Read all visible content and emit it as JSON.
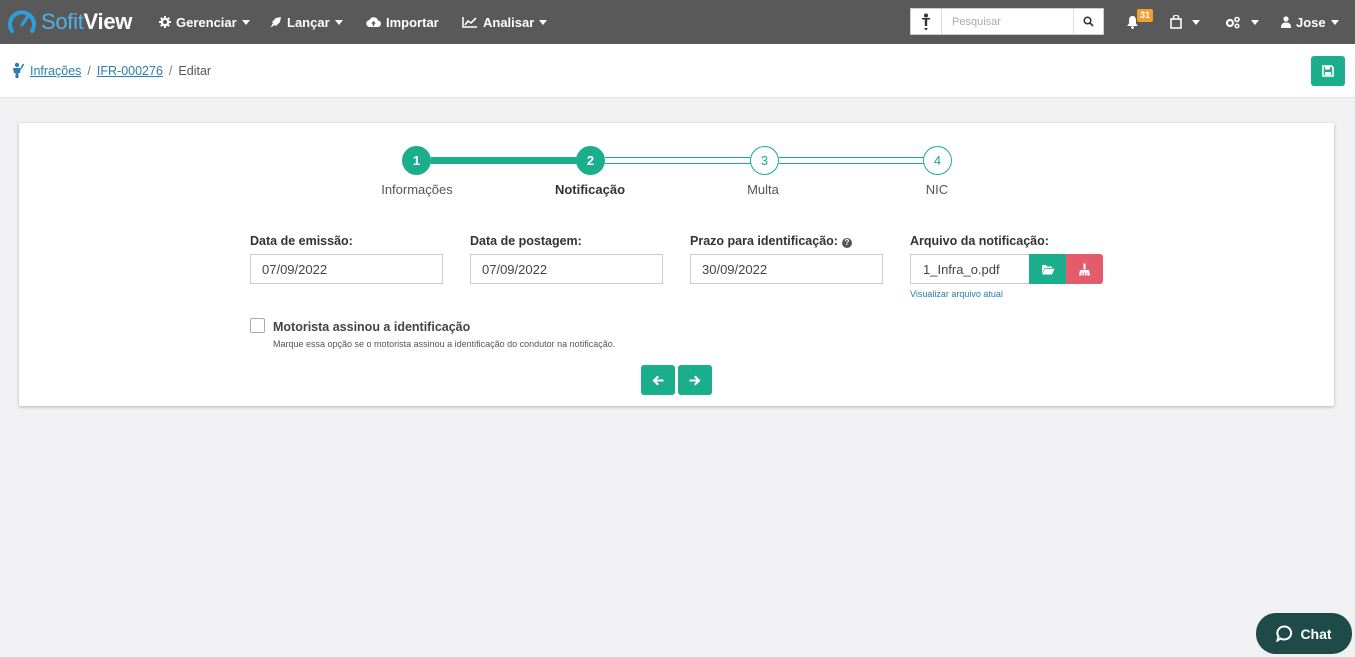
{
  "app": {
    "logo_soft": "Sofit",
    "logo_view": "View"
  },
  "nav": {
    "items": [
      {
        "label": "Gerenciar",
        "icon": "gear-icon",
        "dropdown": true
      },
      {
        "label": "Lançar",
        "icon": "rocket-icon",
        "dropdown": true
      },
      {
        "label": "Importar",
        "icon": "cloud-upload-icon",
        "dropdown": false
      },
      {
        "label": "Analisar",
        "icon": "line-chart-icon",
        "dropdown": true
      }
    ],
    "search_placeholder": "Pesquisar",
    "notifications_count": "31",
    "user": "Jose"
  },
  "breadcrumb": {
    "items": [
      "Infrações",
      "IFR-000276"
    ],
    "current": "Editar"
  },
  "stepper": {
    "steps": [
      {
        "num": "1",
        "label": "Informações",
        "state": "done"
      },
      {
        "num": "2",
        "label": "Notificação",
        "state": "active"
      },
      {
        "num": "3",
        "label": "Multa",
        "state": "todo"
      },
      {
        "num": "4",
        "label": "NIC",
        "state": "todo"
      }
    ]
  },
  "form": {
    "emissao_label": "Data de emissão:",
    "emissao_value": "07/09/2022",
    "postagem_label": "Data de postagem:",
    "postagem_value": "07/09/2022",
    "prazo_label": "Prazo para identificação:",
    "prazo_value": "30/09/2022",
    "arquivo_label": "Arquivo da notificação:",
    "arquivo_value": "1_Infra_o.pdf",
    "view_link": "Visualizar arquivo atual",
    "checkbox_label": "Motorista assinou a identificação",
    "checkbox_help": "Marque essa opção se o motorista assinou a identificação do condutor na notificação.",
    "checkbox_checked": false
  },
  "chat": {
    "label": "Chat"
  },
  "colors": {
    "accent": "#1bae8d",
    "danger": "#e45b6b",
    "topbar": "#595959",
    "chat": "#1f4a4a"
  }
}
